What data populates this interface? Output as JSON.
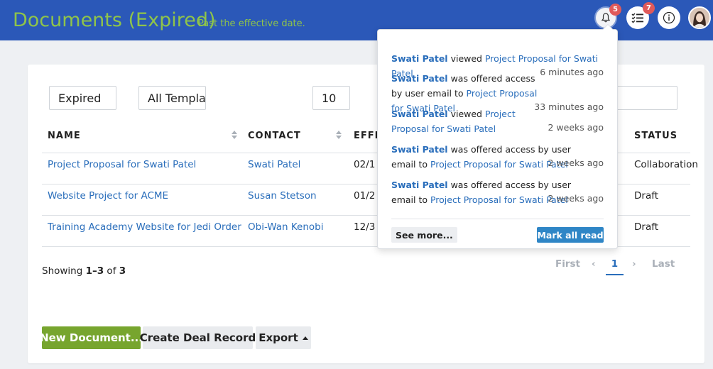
{
  "header": {
    "title": "Documents (Expired)",
    "subtitle": "Past the effective date.",
    "notifications_count": "5",
    "tasks_count": "7"
  },
  "filters": {
    "status_value": "Expired",
    "template_value": "All Templates",
    "page_size_value": "10"
  },
  "table": {
    "columns": [
      "NAME",
      "CONTACT",
      "EFFE",
      "STATUS"
    ],
    "rows": [
      {
        "name": "Project Proposal for Swati Patel",
        "contact": "Swati Patel",
        "date": "02/1",
        "status": "Collaboration"
      },
      {
        "name": "Website Project for ACME",
        "contact": "Susan Stetson",
        "date": "01/2",
        "status": "Draft"
      },
      {
        "name": "Training Academy Website for Jedi Order",
        "contact": "Obi-Wan Kenobi",
        "date": "12/3",
        "status": "Draft"
      }
    ]
  },
  "footer": {
    "showing_prefix": "Showing ",
    "showing_range": "1–3",
    "showing_of": " of ",
    "showing_total": "3"
  },
  "pagination": {
    "first": "First",
    "prev": "‹",
    "current": "1",
    "next": "›",
    "last": "Last"
  },
  "buttons": {
    "new_document": "New Document...",
    "create_deal": "Create Deal Record",
    "export": "Export"
  },
  "notifications": {
    "items": [
      {
        "who": "Swati Patel",
        "action": " viewed ",
        "doc": "Project Proposal for Swati Patel",
        "time": "6 minutes ago"
      },
      {
        "who": "Swati Patel",
        "action": " was offered access by user email to ",
        "doc": "Project Proposal for Swati Patel",
        "time": "33 minutes ago"
      },
      {
        "who": "Swati Patel",
        "action": " viewed ",
        "doc": "Project Proposal for Swati Patel",
        "time": "2 weeks ago"
      },
      {
        "who": "Swati Patel",
        "action": " was offered access by user email to ",
        "doc": "Project Proposal for Swati Patel",
        "time": "2 weeks ago"
      },
      {
        "who": "Swati Patel",
        "action": " was offered access by user email to ",
        "doc": "Project Proposal for Swati Patel",
        "time": "2 weeks ago"
      }
    ],
    "see_more": "See more...",
    "mark_all_read": "Mark all read"
  },
  "colors": {
    "header_bg": "#2b58b8",
    "title_green": "#8fc44a",
    "link_blue": "#2a6ebb",
    "primary_green": "#77a52e",
    "badge_red": "#e05a5a",
    "mark_read_blue": "#2f86c6"
  },
  "icons": [
    "bell-icon",
    "task-list-icon",
    "info-icon",
    "sort-icon",
    "caret-up-icon"
  ]
}
